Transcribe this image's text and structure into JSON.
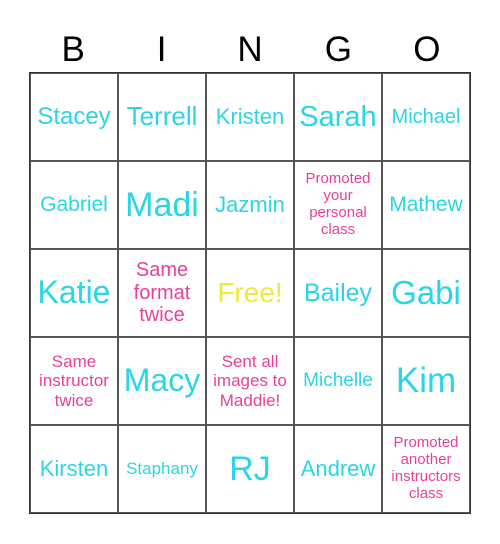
{
  "colors": {
    "name": "#2ad5e6",
    "task": "#e8409a",
    "free": "#eeea3a",
    "grid": "#555555",
    "header": "#000000"
  },
  "header": [
    "B",
    "I",
    "N",
    "G",
    "O"
  ],
  "cells": [
    {
      "text": "Stacey",
      "kind": "name",
      "size": 24
    },
    {
      "text": "Terrell",
      "kind": "name",
      "size": 26
    },
    {
      "text": "Kristen",
      "kind": "name",
      "size": 22
    },
    {
      "text": "Sarah",
      "kind": "name",
      "size": 29
    },
    {
      "text": "Michael",
      "kind": "name",
      "size": 20
    },
    {
      "text": "Gabriel",
      "kind": "name",
      "size": 21
    },
    {
      "text": "Madi",
      "kind": "name",
      "size": 34
    },
    {
      "text": "Jazmin",
      "kind": "name",
      "size": 22
    },
    {
      "text": "Promoted your personal class",
      "kind": "task",
      "size": 15
    },
    {
      "text": "Mathew",
      "kind": "name",
      "size": 21
    },
    {
      "text": "Katie",
      "kind": "name",
      "size": 32
    },
    {
      "text": "Same format twice",
      "kind": "task",
      "size": 20
    },
    {
      "text": "Free!",
      "kind": "free",
      "size": 28
    },
    {
      "text": "Bailey",
      "kind": "name",
      "size": 25
    },
    {
      "text": "Gabi",
      "kind": "name",
      "size": 33
    },
    {
      "text": "Same instructor twice",
      "kind": "task",
      "size": 17
    },
    {
      "text": "Macy",
      "kind": "name",
      "size": 32
    },
    {
      "text": "Sent all images to Maddie!",
      "kind": "task",
      "size": 17
    },
    {
      "text": "Michelle",
      "kind": "name",
      "size": 19
    },
    {
      "text": "Kim",
      "kind": "name",
      "size": 35
    },
    {
      "text": "Kirsten",
      "kind": "name",
      "size": 22
    },
    {
      "text": "Staphany",
      "kind": "name",
      "size": 17
    },
    {
      "text": "RJ",
      "kind": "name",
      "size": 34
    },
    {
      "text": "Andrew",
      "kind": "name",
      "size": 22
    },
    {
      "text": "Promoted another instructors class",
      "kind": "task",
      "size": 15
    }
  ]
}
